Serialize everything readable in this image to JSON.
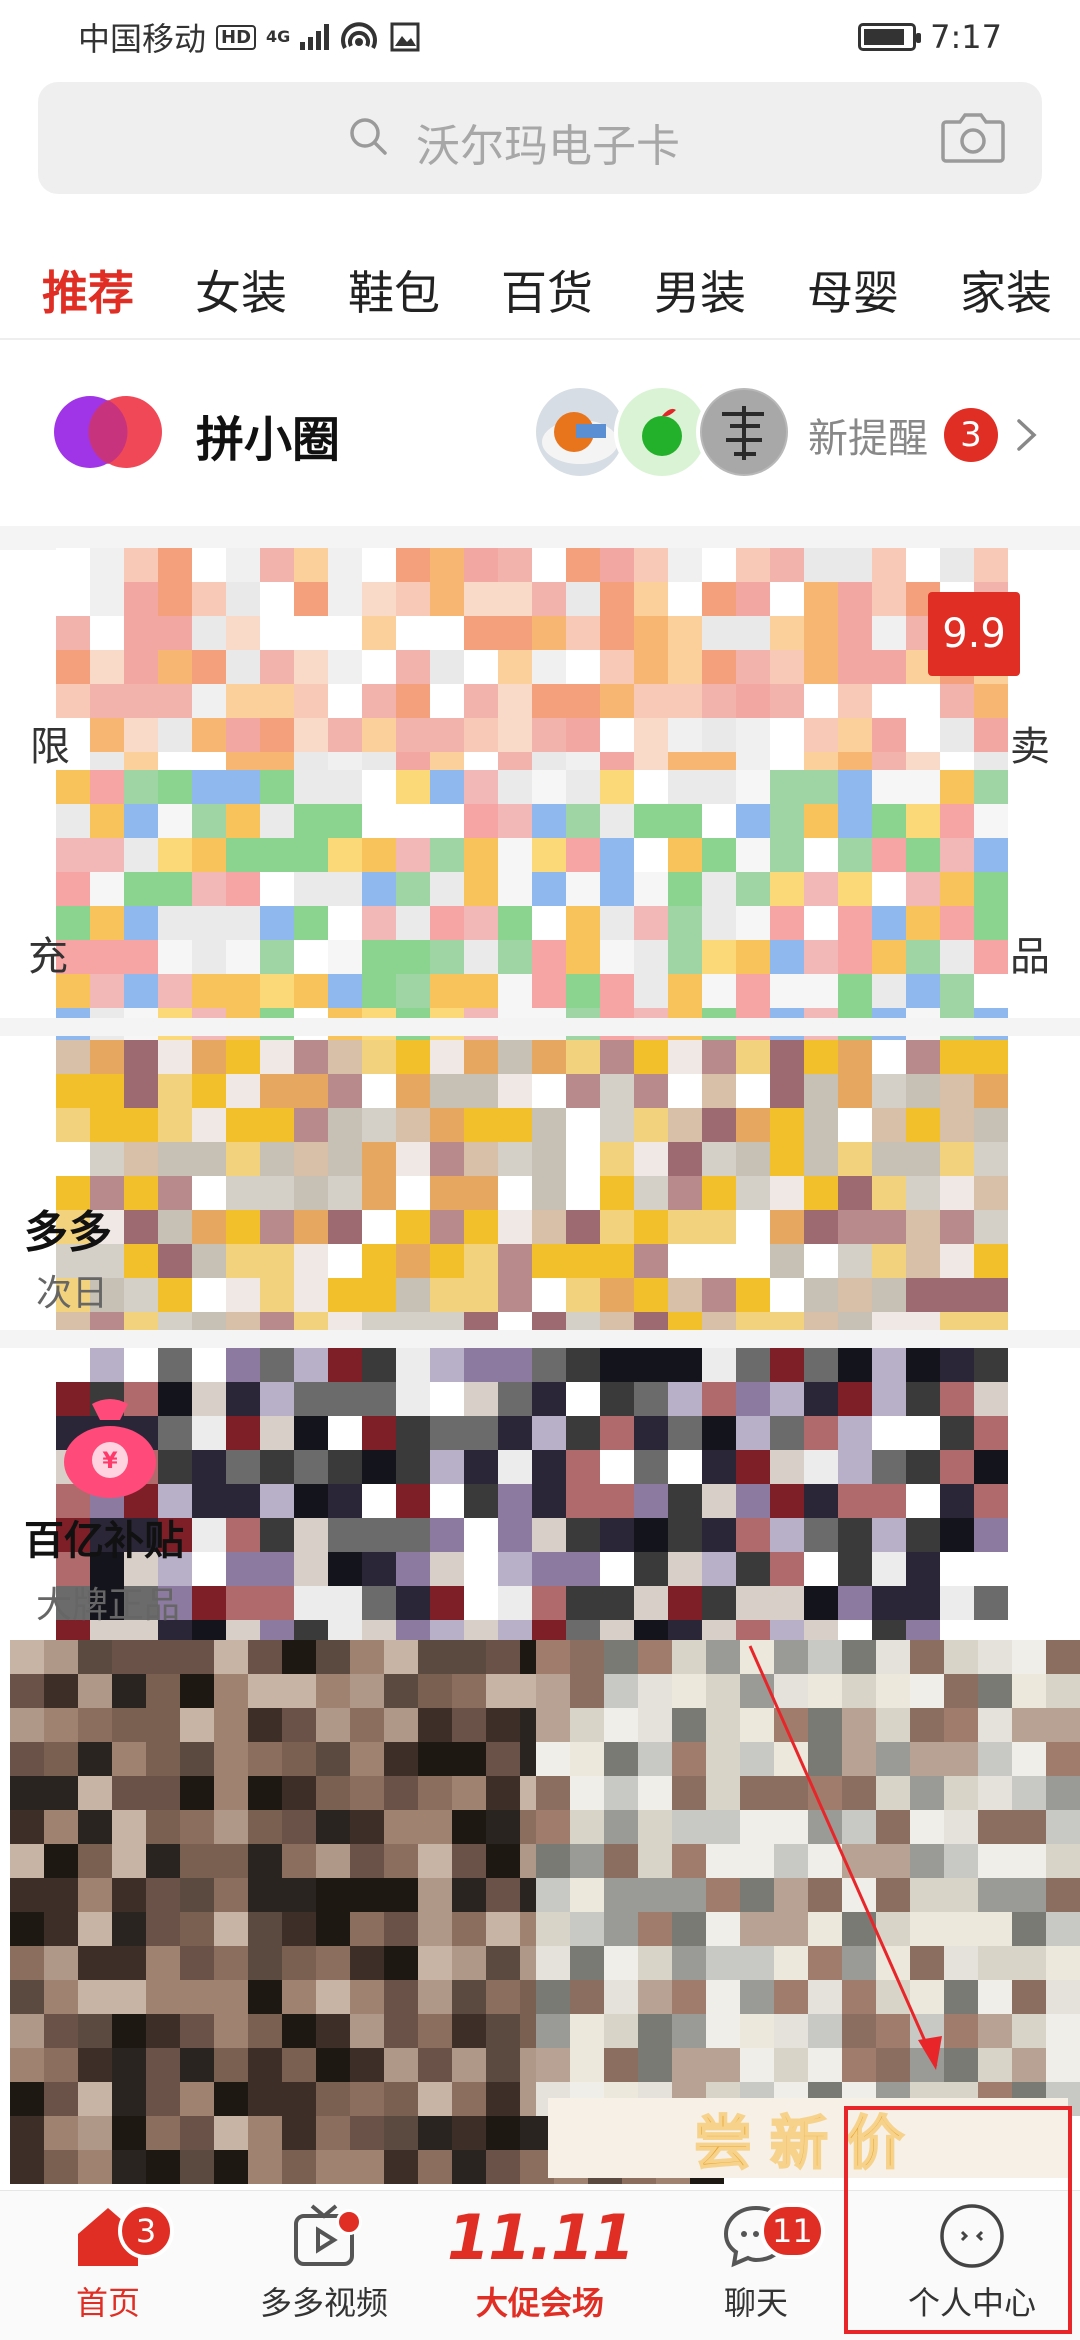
{
  "status_bar": {
    "carrier": "中国移动",
    "hd": "HD",
    "net": "4G",
    "time": "7:17"
  },
  "search": {
    "placeholder": "沃尔玛电子卡"
  },
  "tabs": [
    "推荐",
    "女装",
    "鞋包",
    "百货",
    "男装",
    "母婴",
    "家装"
  ],
  "circle": {
    "title": "拼小圈",
    "remind_text": "新提醒",
    "remind_count": "3"
  },
  "fragments": {
    "badge_99": "9.9",
    "row1_left": "限",
    "row1_right": "卖",
    "row2_left": "充",
    "row2_right": "品",
    "section2_title": "多多",
    "section2_sub": "次日",
    "subsidy_title": "百亿补贴",
    "subsidy_sub": "大牌正品"
  },
  "promo_strip": "尝新价",
  "bottom_nav": {
    "home": {
      "label": "首页",
      "badge": "3"
    },
    "video": {
      "label": "多多视频"
    },
    "promo": {
      "title": "11.11",
      "label": "大促会场"
    },
    "chat": {
      "label": "聊天",
      "badge": "11"
    },
    "profile": {
      "label": "个人中心"
    }
  },
  "colors": {
    "brand_red": "#e02e24",
    "annotation_red": "#e8262a"
  }
}
